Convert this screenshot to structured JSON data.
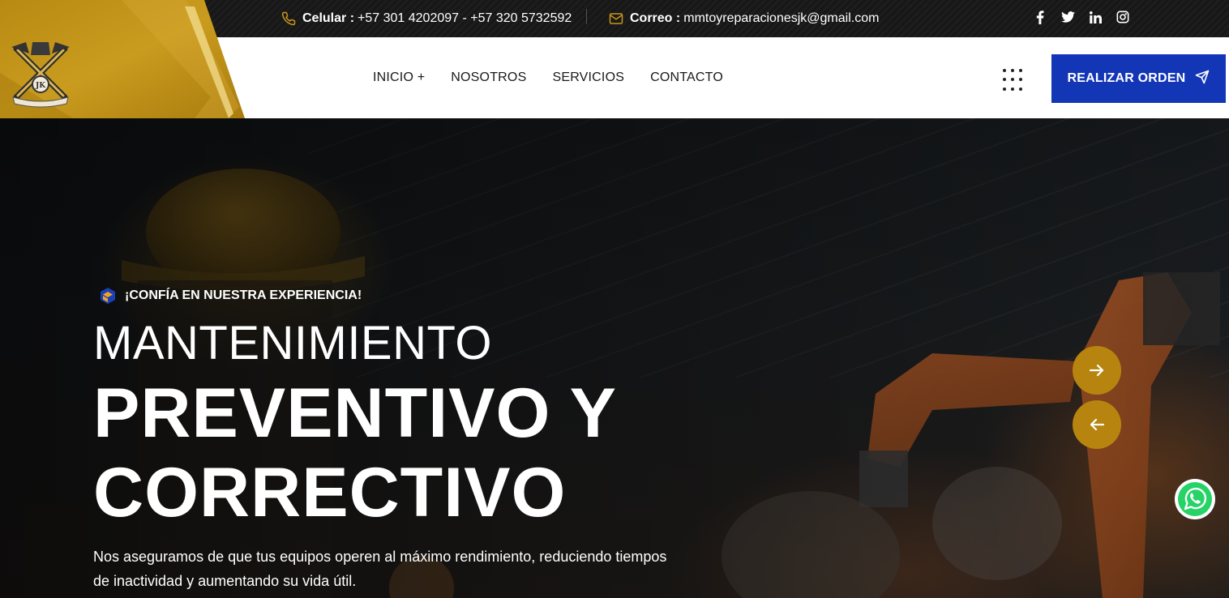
{
  "topbar": {
    "phone_label": "Celular :",
    "phone_value": "+57 301 4202097 - +57 320 5732592",
    "email_label": "Correo :",
    "email_value": "mmtoyreparacionesjk@gmail.com",
    "social_icons": [
      "facebook-icon",
      "twitter-icon",
      "linkedin-icon",
      "instagram-icon"
    ]
  },
  "nav": {
    "items": [
      {
        "label": "INICIO +"
      },
      {
        "label": "NOSOTROS"
      },
      {
        "label": "SERVICIOS"
      },
      {
        "label": "CONTACTO"
      }
    ],
    "order_button": "REALIZAR ORDEN"
  },
  "hero": {
    "tagline": "¡CONFÍA EN NUESTRA EXPERIENCIA!",
    "title_line1": "MANTENIMIENTO",
    "title_line2": "PREVENTIVO Y",
    "title_line3": "CORRECTIVO",
    "description": "Nos aseguramos de que tus equipos operen al máximo rendimiento, reduciendo tiempos de inactividad y aumentando su vida útil."
  },
  "colors": {
    "accent_gold": "#b7850f",
    "button_blue": "#1336b7",
    "topbar_dark": "#1b1b1b"
  }
}
